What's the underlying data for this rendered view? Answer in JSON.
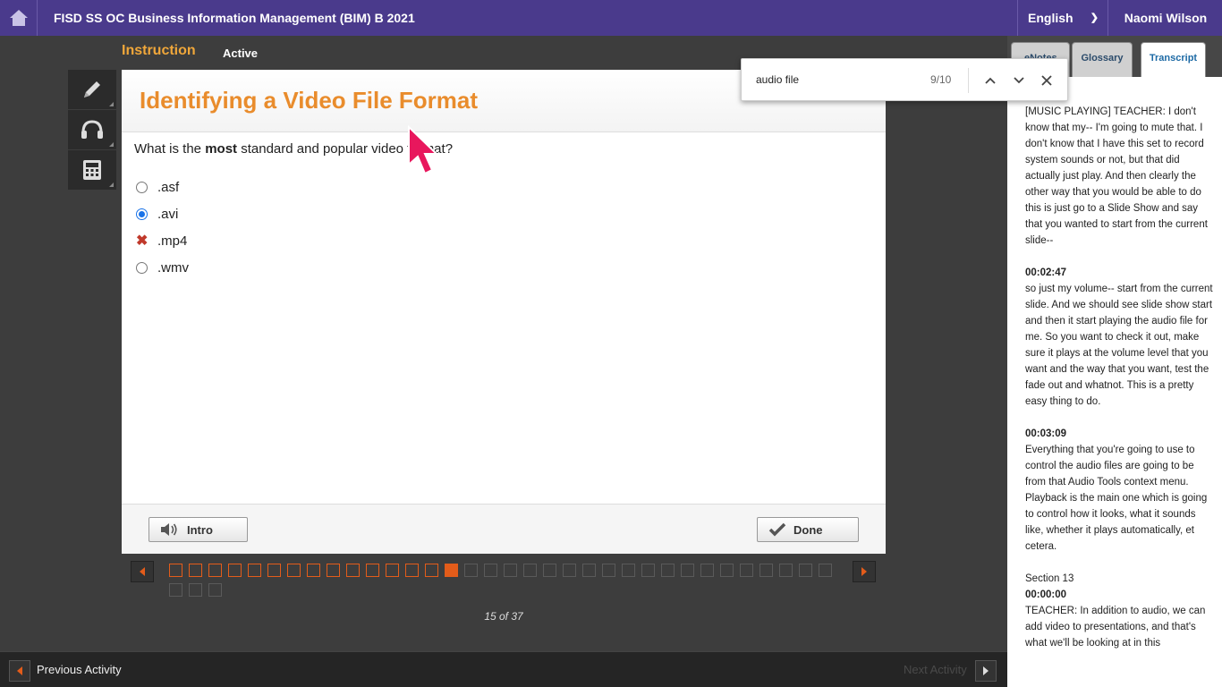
{
  "header": {
    "course_title": "FISD SS OC Business Information Management (BIM) B 2021",
    "language": "English",
    "user_name": "Naomi Wilson"
  },
  "subheader": {
    "phase": "Instruction",
    "status": "Active"
  },
  "tools": [
    "pencil-icon",
    "headphones-icon",
    "calculator-icon"
  ],
  "card": {
    "title": "Identifying a Video File Format",
    "question_pre": "What is the ",
    "question_bold": "most",
    "question_post": " standard and popular video format?",
    "options": [
      {
        "label": ".asf",
        "state": "unselected"
      },
      {
        "label": ".avi",
        "state": "selected"
      },
      {
        "label": ".mp4",
        "state": "incorrect"
      },
      {
        "label": ".wmv",
        "state": "unselected"
      }
    ],
    "intro_label": "Intro",
    "done_label": "Done"
  },
  "progress": {
    "current": 15,
    "total": 37,
    "counter_text": "15 of 37",
    "accent": "#e35c1a"
  },
  "footer": {
    "prev_label": "Previous Activity",
    "next_label": "Next Activity"
  },
  "panel": {
    "tabs": [
      "eNotes",
      "Glossary",
      "Transcript"
    ],
    "active_tab": "Transcript",
    "transcript": [
      {
        "time": "",
        "section": "",
        "text": "[MUSIC PLAYING] TEACHER: I don't know that my-- I'm going to mute that. I don't know that I have this set to record system sounds or not, but that did actually just play. And then clearly the other way that you would be able to do this is just go to a Slide Show and say that you wanted to start from the current slide--"
      },
      {
        "time": "00:02:47",
        "section": "",
        "text": "so just my volume-- start from the current slide. And we should see slide show start and then it start playing the audio file for me. So you want to check it out, make sure it plays at the volume level that you want and the way that you want, test the fade out and whatnot. This is a pretty easy thing to do."
      },
      {
        "time": "00:03:09",
        "section": "",
        "text": "Everything that you're going to use to control the audio files are going to be from that Audio Tools context menu. Playback is the main one which is going to control how it looks, what it sounds like, whether it plays automatically, et cetera."
      },
      {
        "time": "00:00:00",
        "section": "Section 13",
        "text": "TEACHER: In addition to audio, we can add video to presentations, and that's what we'll be looking at in this"
      }
    ]
  },
  "findbar": {
    "query": "audio file",
    "count": "9/10"
  },
  "colors": {
    "brand": "#4a3a8c",
    "title_orange": "#e98c2c",
    "incorrect": "#c0392b",
    "selected": "#1a73e8"
  }
}
